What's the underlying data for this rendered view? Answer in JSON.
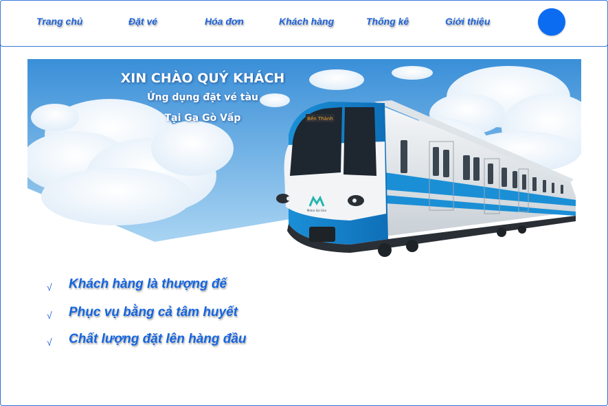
{
  "nav": {
    "items": [
      {
        "label": "Trang chủ"
      },
      {
        "label": "Đặt vé"
      },
      {
        "label": "Hóa đơn"
      },
      {
        "label": "Khách hàng"
      },
      {
        "label": "Thống kê"
      },
      {
        "label": "Giới thiệu"
      }
    ]
  },
  "hero": {
    "title": "XIN CHÀO QUÝ KHÁCH",
    "subtitle": "Ứng dụng đặt vé tàu",
    "station": "Tại Ga Gò Vấp",
    "train_destination": "Bến Thành",
    "train_logo_text": "Metro Sài Gòn"
  },
  "slogans": [
    {
      "check": "√",
      "text": "Khách hàng là thượng đế"
    },
    {
      "check": "√",
      "text": "Phục vụ bằng cả tâm huyết"
    },
    {
      "check": "√",
      "text": "Chất lượng đặt lên hàng đầu"
    }
  ],
  "colors": {
    "accent": "#1565e0",
    "avatar": "#0b6cf2",
    "sky_top": "#3a8fd8",
    "sky_bottom": "#a9d4f2",
    "train_blue": "#1a8fd6"
  },
  "icons": {
    "check": "check-icon",
    "avatar": "avatar-icon"
  }
}
